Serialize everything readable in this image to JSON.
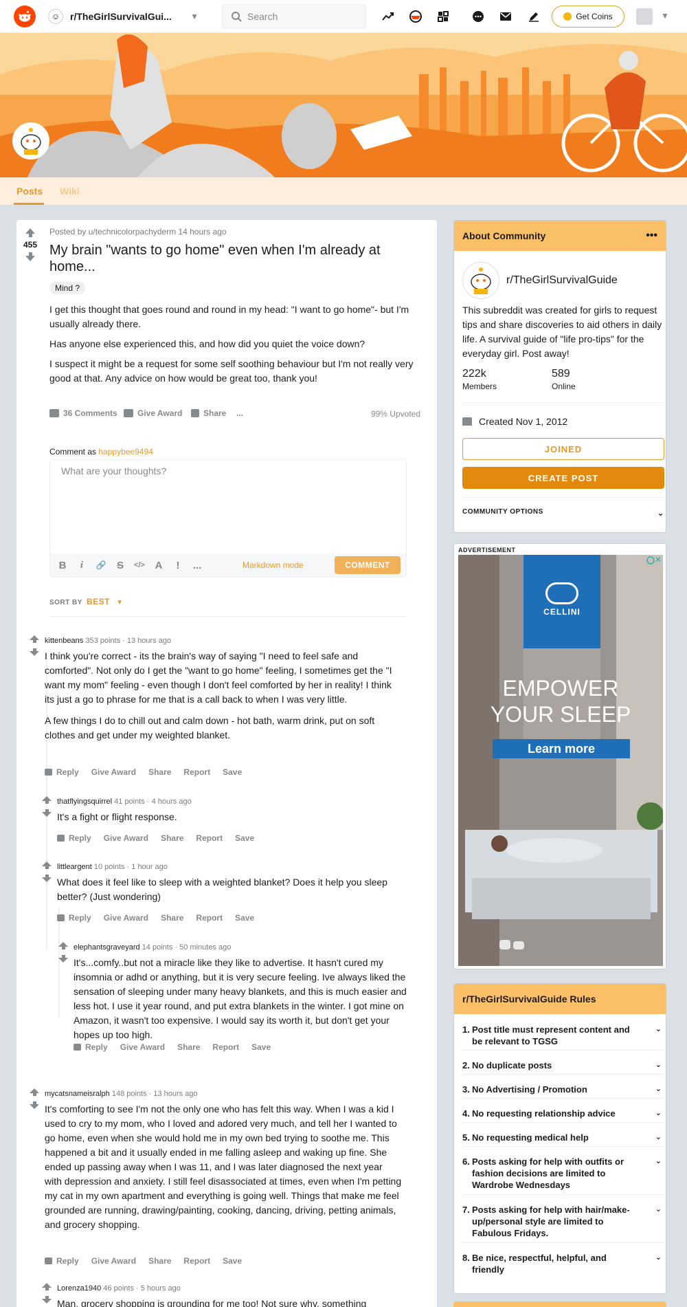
{
  "header": {
    "subreddit": "r/TheGirlSurvivalGui...",
    "search_placeholder": "Search",
    "coins_label": "Get Coins"
  },
  "tabs": [
    "Posts",
    "Wiki"
  ],
  "post": {
    "score": "455",
    "meta": "Posted by u/technicolorpachyderm 14 hours ago",
    "title": "My brain \"wants to go home\" even when I'm already at home...",
    "flair": "Mind ?",
    "body": [
      "I get this thought that goes round and round in my head: \"I want to go home\"- but I'm usually already there.",
      "Has anyone else experienced this, and how did you quiet the voice down?",
      "I suspect it might be a request for some self soothing behaviour but I'm not really very good at that. Any advice on how would be great too, thank you!"
    ],
    "comments_label": "36 Comments",
    "award_label": "Give Award",
    "share_label": "Share",
    "more_label": "...",
    "upvoted": "99% Upvoted"
  },
  "composer": {
    "comment_as_prefix": "Comment as",
    "username": "happybee9494",
    "placeholder": "What are your thoughts?",
    "markdown_label": "Markdown mode",
    "comment_button": "COMMENT",
    "toolbar": [
      "B",
      "i",
      "🔗",
      "S",
      "</>",
      "A",
      "!",
      "..."
    ]
  },
  "sort": {
    "label": "SORT BY",
    "value": "BEST"
  },
  "comments": [
    {
      "author": "kittenbeans",
      "points": "353 points",
      "time": "13 hours ago",
      "body": [
        "I think you're correct - its the brain's way of saying \"I need to feel safe and comforted\". Not only do I get the \"want to go home\" feeling, I sometimes get the \"I want my mom\" feeling - even though I don't feel comforted by her in reality! I think its just a go to phrase for me that is a call back to when I was very little.",
        "A few things I do to chill out and calm down - hot bath, warm drink, put on soft clothes and get under my weighted blanket."
      ]
    },
    {
      "author": "thatflyingsquirrel",
      "points": "41 points",
      "time": "4 hours ago",
      "body": [
        "It's a fight or flight response."
      ]
    },
    {
      "author": "littleargent",
      "points": "10 points",
      "time": "1 hour ago",
      "body": [
        "What does it feel like to sleep with a weighted blanket? Does it help you sleep better? (Just wondering)"
      ]
    },
    {
      "author": "elephantsgraveyard",
      "points": "14 points",
      "time": "50 minutes ago",
      "body": [
        "It's...comfy..but not a miracle like they like to advertise. It hasn't cured my insomnia or adhd or anything, but it is very secure feeling. Ive always liked the sensation of sleeping under many heavy blankets, and this is much easier and less hot. I use it year round, and put extra blankets in the winter. I got mine on Amazon, it wasn't too expensive. I would say its worth it, but don't get your hopes up too high."
      ]
    },
    {
      "author": "mycatsnameisralph",
      "points": "148 points",
      "time": "13 hours ago",
      "body": [
        "It's comforting to see I'm not the only one who has felt this way. When I was a kid I used to cry to my mom, who I loved and adored very much, and tell her I wanted to go home, even when she would hold me in my own bed trying to soothe me. This happened a bit and it usually ended in me falling asleep and waking up fine. She ended up passing away when I was 11, and I was later diagnosed the next year with depression and anxiety. I still feel disassociated at times, even when I'm petting my cat in my own apartment and everything is going well. Things that make me feel grounded are running, drawing/painting, cooking, dancing, driving, petting animals, and grocery shopping."
      ]
    },
    {
      "author": "Lorenza1940",
      "points": "46 points",
      "time": "5 hours ago",
      "body": [
        "Man, grocery shopping is grounding for me too! Not sure why, something"
      ]
    }
  ],
  "comment_actions": [
    "Reply",
    "Give Award",
    "Share",
    "Report",
    "Save"
  ],
  "about": {
    "heading": "About Community",
    "name": "r/TheGirlSurvivalGuide",
    "description": "This subreddit was created for girls to request tips and share discoveries to aid others in daily life. A survival guide of \"life pro-tips\" for the everyday girl. Post away!",
    "members": "222k",
    "members_label": "Members",
    "online": "589",
    "online_label": "Online",
    "created": "Created Nov 1, 2012",
    "joined_button": "JOINED",
    "create_button": "CREATE POST",
    "options_label": "COMMUNITY OPTIONS"
  },
  "ad": {
    "label": "ADVERTISEMENT",
    "brand": "CELLINI",
    "headline_1": "EMPOWER",
    "headline_2": "YOUR SLEEP",
    "cta": "Learn more"
  },
  "rules": {
    "heading": "r/TheGirlSurvivalGuide Rules",
    "items": [
      "Post title must represent content and be relevant to TGSG",
      "No duplicate posts",
      "No Advertising / Promotion",
      "No requesting relationship advice",
      "No requesting medical help",
      "Posts asking for help with outfits or fashion decisions are limited to Wardrobe Wednesdays",
      "Posts asking for help with hair/make-up/personal style are limited to Fabulous Fridays.",
      "Be nice, respectful, helpful, and friendly"
    ]
  },
  "colors": {
    "accent": "#e39a2e",
    "banner": "#f79a3e",
    "side_header": "#fbbf68",
    "reddit": "#ff4500"
  }
}
